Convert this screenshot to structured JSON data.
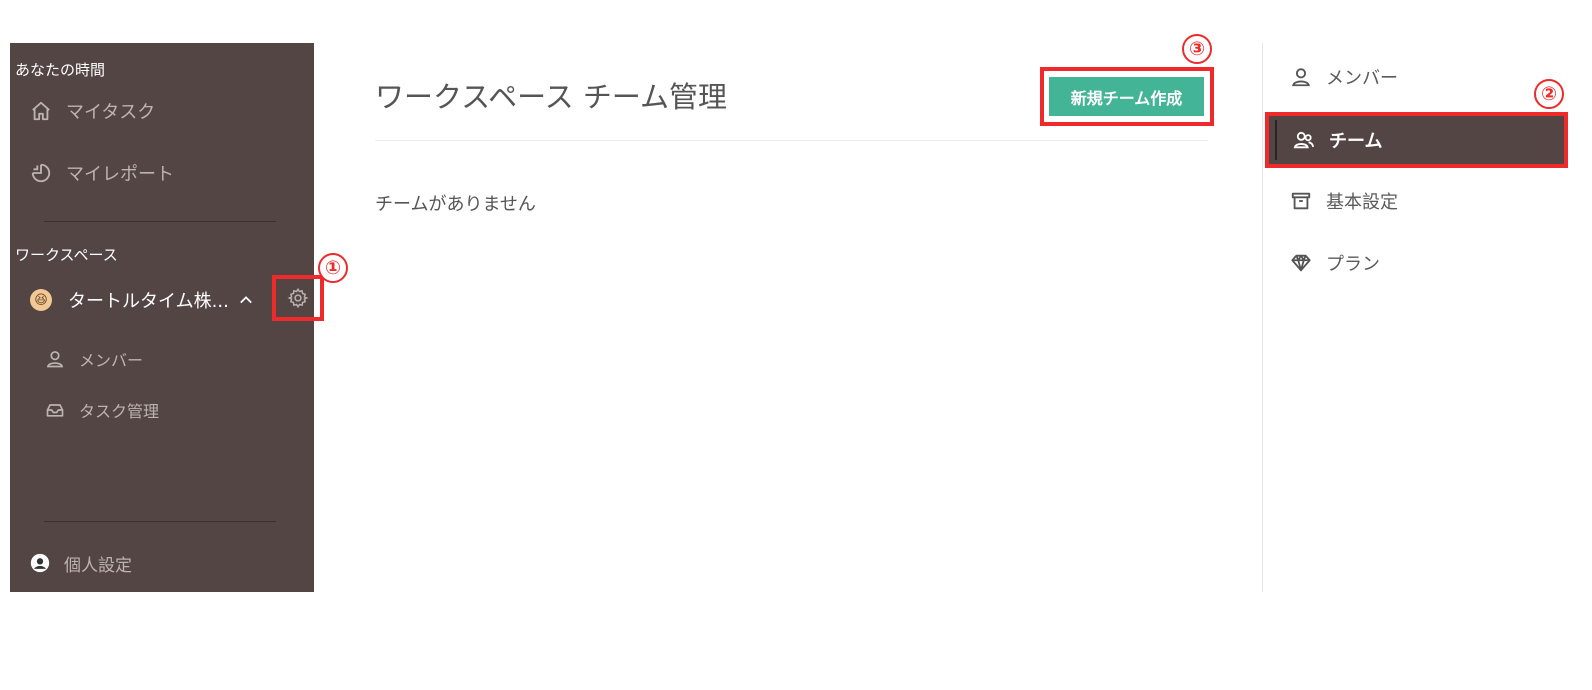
{
  "sidebar": {
    "app_title": "あなたの時間",
    "my_tasks": "マイタスク",
    "my_report": "マイレポート",
    "workspace_heading": "ワークスペース",
    "workspace_name": "タートルタイム株...",
    "workspace_emoji": "😆",
    "sub_members": "メンバー",
    "sub_task_management": "タスク管理",
    "personal_settings": "個人設定"
  },
  "main": {
    "title": "ワークスペース チーム管理",
    "create_button": "新規チーム作成",
    "empty_message": "チームがありません"
  },
  "right_nav": {
    "members": "メンバー",
    "team": "チーム",
    "basic_settings": "基本設定",
    "plan": "プラン"
  },
  "annotations": {
    "one": "①",
    "two": "②",
    "three": "③"
  },
  "colors": {
    "sidebar_bg": "#534543",
    "accent_green": "#44b497",
    "highlight_red": "#ee2a2a"
  }
}
